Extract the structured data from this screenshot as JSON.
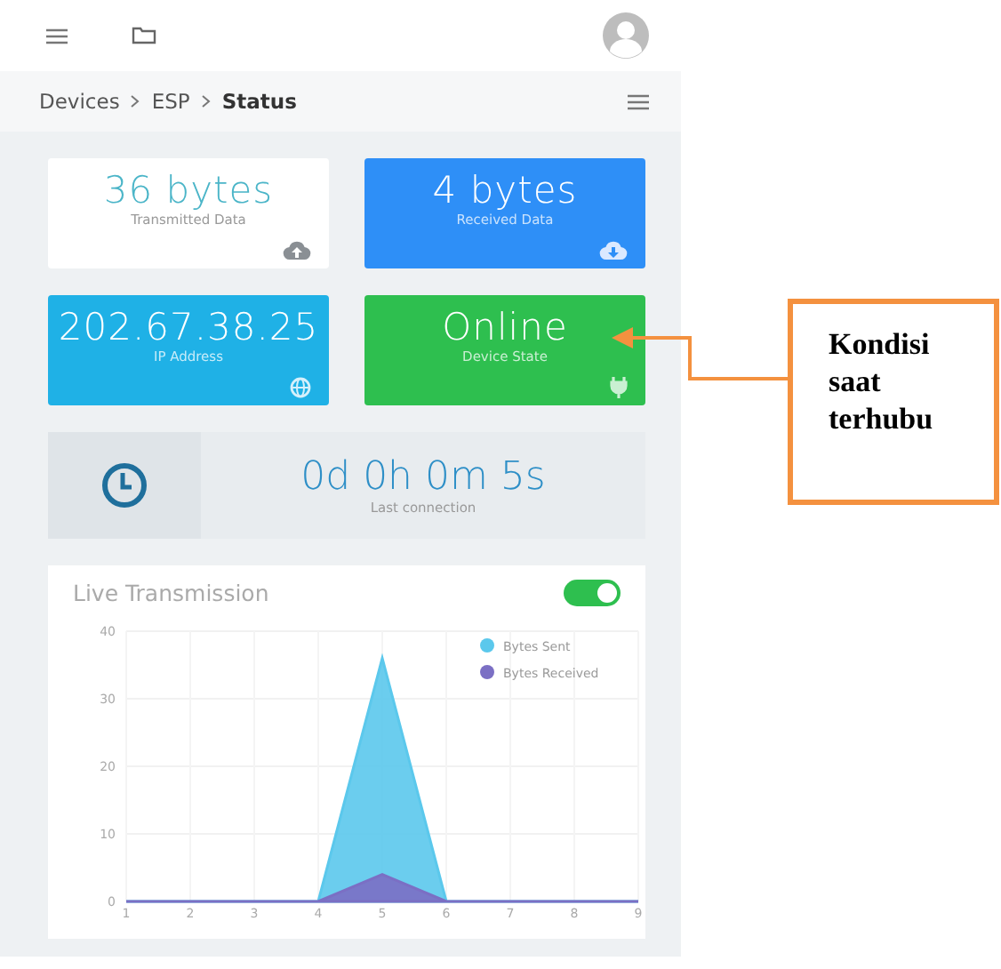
{
  "breadcrumb": [
    "Devices",
    "ESP",
    "Status"
  ],
  "cards": [
    {
      "value": "36 bytes",
      "label": "Transmitted Data",
      "kind": "upload",
      "color": "#ffffff"
    },
    {
      "value": "4 bytes",
      "label": "Received Data",
      "kind": "download",
      "color": "#2e8ff7"
    },
    {
      "value": "202.67.38.25",
      "label": "IP Address",
      "kind": "globe",
      "color": "#1fb1e6"
    },
    {
      "value": "Online",
      "label": "Device State",
      "kind": "plug",
      "color": "#2ebf4f"
    }
  ],
  "last_connection": {
    "value": "0d 0h 0m 5s",
    "label": "Last connection"
  },
  "live": {
    "title": "Live Transmission",
    "on": true,
    "chart_data": {
      "type": "area",
      "x": [
        1,
        2,
        3,
        4,
        5,
        6,
        7,
        8,
        9
      ],
      "xlim": [
        1,
        9
      ],
      "grid": true,
      "legend": true,
      "ylim": [
        0,
        40
      ],
      "yticks": [
        0,
        10,
        20,
        30,
        40
      ],
      "xticks": [
        1,
        2,
        3,
        4,
        5,
        6,
        7,
        8,
        9
      ],
      "series": [
        {
          "name": "Bytes Sent",
          "color": "#5bc8ec",
          "values": [
            0,
            0,
            0,
            0,
            36,
            0,
            0,
            0,
            0
          ]
        },
        {
          "name": "Bytes Received",
          "color": "#7b6fc4",
          "values": [
            0,
            0,
            0,
            0,
            4,
            0,
            0,
            0,
            0
          ]
        }
      ]
    }
  },
  "callout": {
    "text": "Kondisi saat terhubu"
  }
}
